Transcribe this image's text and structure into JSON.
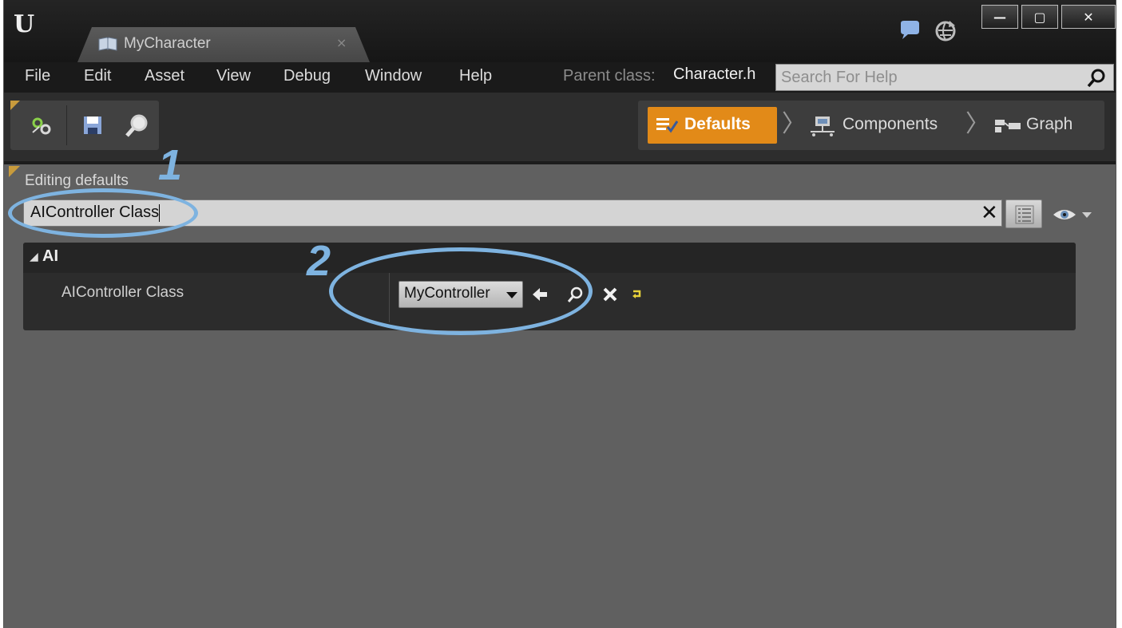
{
  "window": {
    "tab_title": "MyCharacter",
    "tab_close": "×",
    "controls": {
      "minimize": "—",
      "maximize": "▢",
      "close": "✕"
    }
  },
  "menu": {
    "items": [
      "File",
      "Edit",
      "Asset",
      "View",
      "Debug",
      "Window",
      "Help"
    ],
    "parent_class_label": "Parent class:",
    "parent_class_value": "Character.h",
    "help_search_placeholder": "Search For Help"
  },
  "modes": {
    "defaults": "Defaults",
    "components": "Components",
    "graph": "Graph",
    "separator": "〉"
  },
  "details": {
    "editing_label": "Editing defaults",
    "search_value": "AIController Class",
    "clear": "✕",
    "category": {
      "arrow": "◢",
      "name": "AI",
      "property": {
        "name": "AIController Class",
        "value": "MyController"
      }
    }
  },
  "annotations": {
    "one": "1",
    "two": "2"
  },
  "colors": {
    "accent_orange": "#e28a18",
    "annotation_blue": "#7eb3e0",
    "panel_gray": "#606060"
  }
}
